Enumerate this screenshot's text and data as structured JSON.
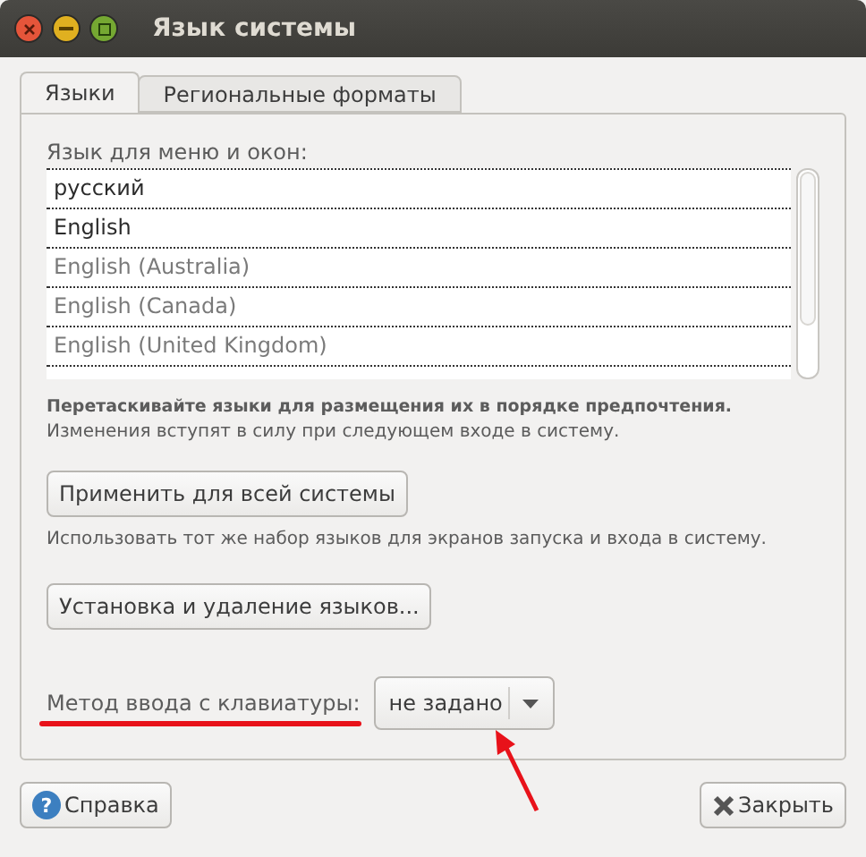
{
  "window": {
    "title": "Язык системы"
  },
  "tabs": [
    {
      "label": "Языки",
      "selected": true
    },
    {
      "label": "Региональные форматы",
      "selected": false
    }
  ],
  "language_list": {
    "label": "Язык для меню и окон:",
    "items": [
      {
        "name": "русский",
        "enabled": true
      },
      {
        "name": "English",
        "enabled": true
      },
      {
        "name": "English (Australia)",
        "enabled": false
      },
      {
        "name": "English (Canada)",
        "enabled": false
      },
      {
        "name": "English (United Kingdom)",
        "enabled": false
      }
    ]
  },
  "drag_hint": "Перетаскивайте языки для размещения их в порядке предпочтения.",
  "change_note": "Изменения вступят в силу при следующем входе в систему.",
  "apply_button": "Применить для всей системы",
  "apply_note": "Использовать тот же набор языков для экранов запуска и входа в систему.",
  "install_button": "Установка и удаление языков...",
  "input_method": {
    "label": "Метод ввода с клавиатуры:",
    "value": "не задано"
  },
  "annotations": {
    "label_underlined": true,
    "arrow_to_dropdown": true
  },
  "buttons": [
    {
      "kind": "help",
      "icon": "?",
      "label": "Справка"
    },
    {
      "kind": "close",
      "label": "Закрыть"
    }
  ]
}
